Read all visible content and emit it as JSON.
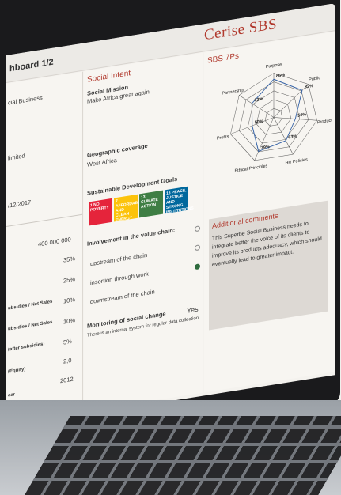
{
  "header": {
    "dashboard_title": "hboard 1/2",
    "brand": "Cerise SBS"
  },
  "left_col": {
    "rows": [
      "cial Business",
      "limited",
      "/12/2017"
    ],
    "values": [
      "400 000 000",
      "35%",
      "25%",
      "10%",
      "10%",
      "5%",
      "2,0",
      "2012"
    ],
    "labels": [
      "ubsidies / Net Sales",
      "ubsidies / Net Sales",
      "(after subsidies)",
      "(Equity)",
      "ear"
    ]
  },
  "social_intent": {
    "title": "Social Intent",
    "mission_label": "Social Mission",
    "mission_value": "Make Africa great again",
    "geo_label": "Geographic coverage",
    "geo_value": "West Africa",
    "sdg_label": "Sustainable Development Goals",
    "sdg_icons": [
      {
        "num": "1",
        "text": "NO POVERTY",
        "color": "#e5243b"
      },
      {
        "num": "7",
        "text": "AFFORDABLE AND CLEAN ENERGY",
        "color": "#fcc30b"
      },
      {
        "num": "13",
        "text": "CLIMATE ACTION",
        "color": "#3f7e44"
      },
      {
        "num": "16",
        "text": "PEACE, JUSTICE AND STRONG INSTITUTIONS",
        "color": "#00689d"
      }
    ],
    "value_chain_label": "Involvement in the value chain:",
    "value_chain_items": [
      "upstream of the chain",
      "insertion through work",
      "downstream of the chain"
    ],
    "monitoring_label": "Monitoring of social change",
    "monitoring_text": "There is an internal system for regular data collection",
    "monitoring_value": "Yes"
  },
  "sbs7p": {
    "title": "SBS 7Ps",
    "axes": [
      "Purpose",
      "Public",
      "Product",
      "HR Policies",
      "Principles",
      "Profits",
      "Partnership"
    ],
    "axis_labels": [
      "Purpose",
      "Public",
      "Product",
      "HR Policies",
      "Ethical Principles",
      "Profits",
      "Partnership"
    ],
    "values_label": [
      "86%",
      "82%",
      "50%",
      "63%",
      "79%",
      "50%",
      "63%"
    ],
    "chart_data": {
      "type": "radar",
      "categories": [
        "Purpose",
        "Public",
        "Product",
        "HR Policies",
        "Ethical Principles",
        "Profits",
        "Partnership"
      ],
      "values": [
        86,
        82,
        50,
        63,
        79,
        50,
        63
      ],
      "ylim": [
        0,
        100
      ]
    }
  },
  "comments": {
    "title": "Additional comments",
    "text": "This Superbe Social Business needs to integrate better the voice of its clients to improve its products adequacy, which should eventually lead to greater impact."
  },
  "colors": {
    "accent": "#b13a2e",
    "radar_line": "#3a66a8"
  }
}
